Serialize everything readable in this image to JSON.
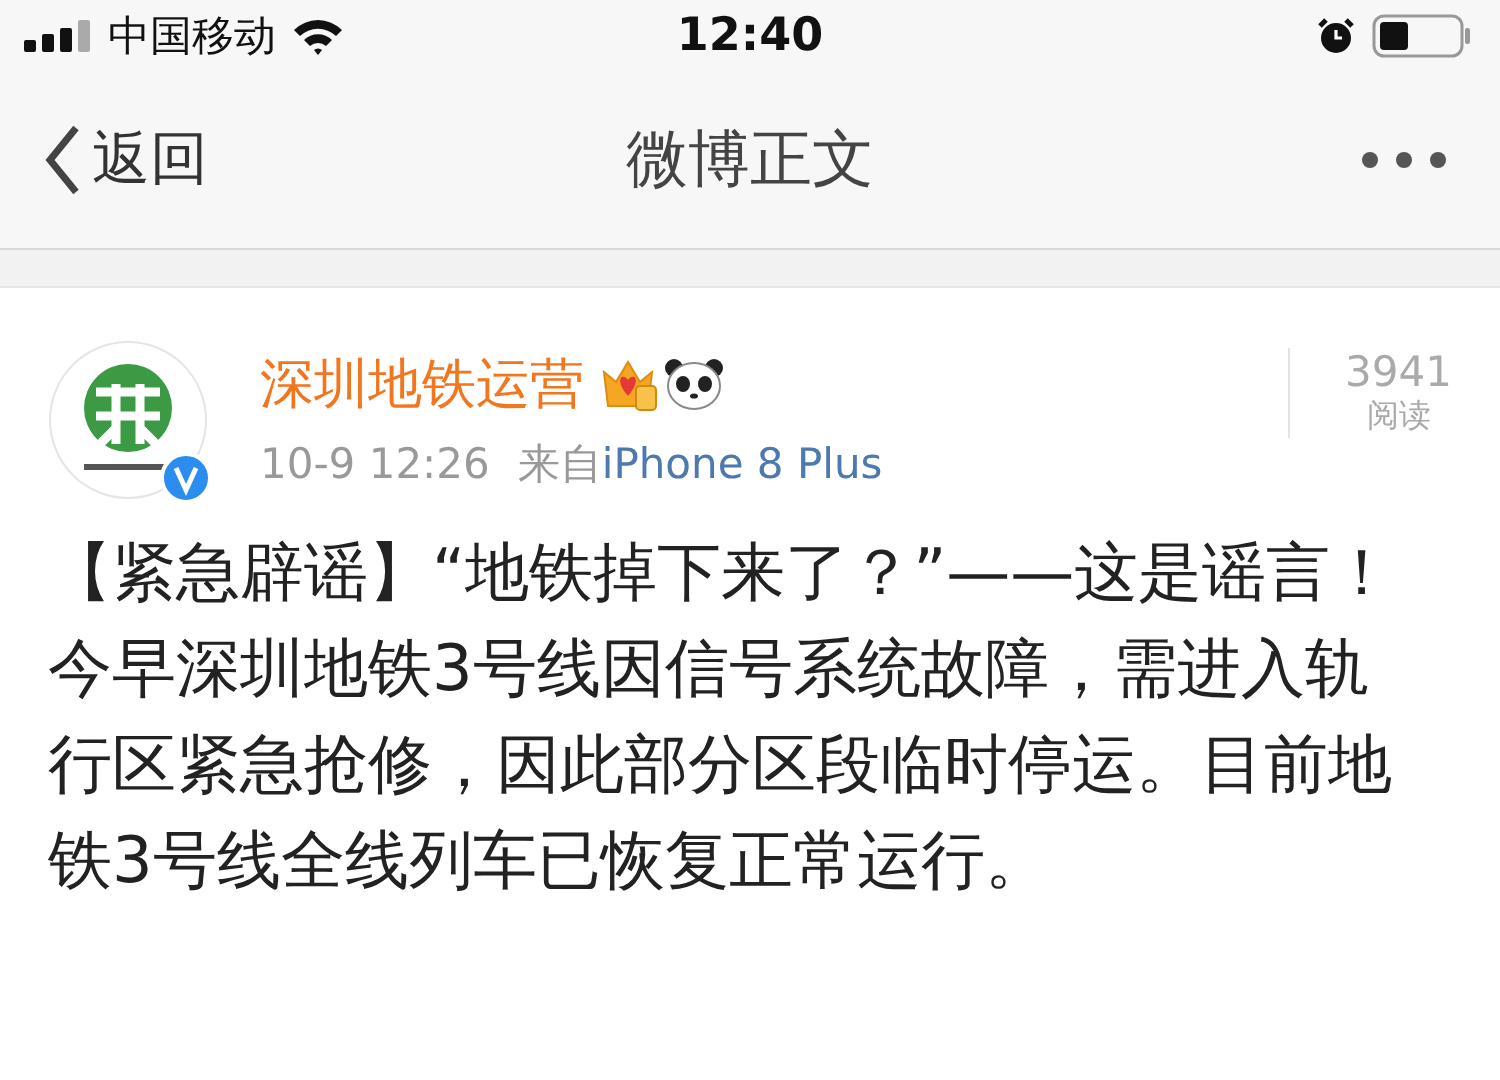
{
  "status_bar": {
    "carrier": "中国移动",
    "time": "12:40"
  },
  "nav": {
    "back": "返回",
    "title": "微博正文"
  },
  "post": {
    "author": "深圳地铁运营",
    "time": "10-9 12:26",
    "source_prefix": "来自",
    "source": "iPhone 8 Plus",
    "reads": "3941",
    "reads_label": "阅读",
    "verified": true,
    "text": "【紧急辟谣】“地铁掉下来了？”——这是谣言！今早深圳地铁3号线因信号系统故障，需进入轨行区紧急抢修，因此部分区段临时停运。目前地铁3号线全线列车已恢复正常运行。"
  }
}
